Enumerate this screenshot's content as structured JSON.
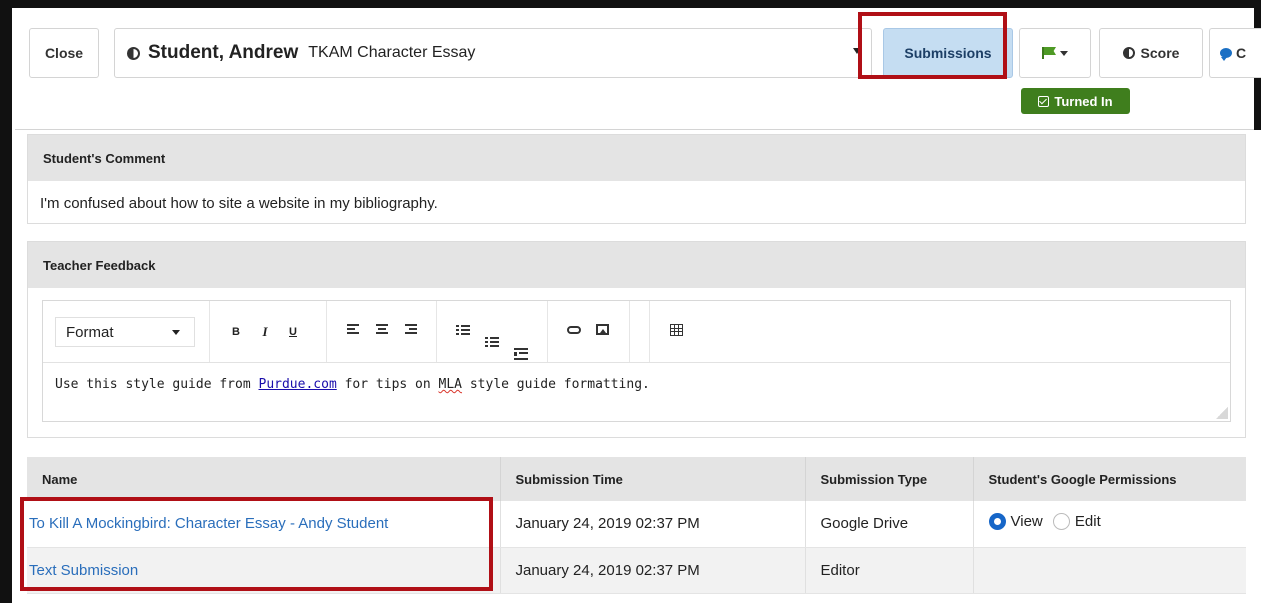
{
  "header": {
    "close_label": "Close",
    "student_name": "Student, Andrew",
    "assignment_name": "TKAM Character Essay",
    "submissions_label": "Submissions",
    "score_label": "Score",
    "comments_label_visible": "C",
    "turned_in_label": "Turned In",
    "status_color": "#3f7e1d",
    "highlight_color": "#b00f16"
  },
  "student_comment": {
    "title": "Student's Comment",
    "text": "I'm confused about how to site a website in my bibliography."
  },
  "teacher_feedback": {
    "title": "Teacher Feedback",
    "format_select": "Format",
    "toolbar": {
      "bold": "B",
      "italic": "I",
      "underline": "U"
    },
    "text_before_link": "Use this style guide from ",
    "link_text": "Purdue.com",
    "text_after_link_1": " for tips on ",
    "misspelled_word": "MLA",
    "text_after_link_2": " style guide formatting."
  },
  "submissions_table": {
    "headers": [
      "Name",
      "Submission Time",
      "Submission Type",
      "Student's Google Permissions"
    ],
    "rows": [
      {
        "name": "To Kill A Mockingbird: Character Essay - Andy Student",
        "time": "January 24, 2019 02:37 PM",
        "type": "Google Drive",
        "perm_view": "View",
        "perm_edit": "Edit"
      },
      {
        "name": "Text Submission",
        "time": "January 24, 2019 02:37 PM",
        "type": "Editor"
      }
    ]
  },
  "icons": [
    "half-circle-icon",
    "caret-down-icon",
    "flag-icon",
    "checkbox-icon",
    "comment-bubble-icon",
    "align-left-icon",
    "align-center-icon",
    "align-right-icon",
    "bullet-list-icon",
    "numbered-list-icon",
    "indent-icon",
    "link-icon",
    "image-icon",
    "table-icon"
  ]
}
